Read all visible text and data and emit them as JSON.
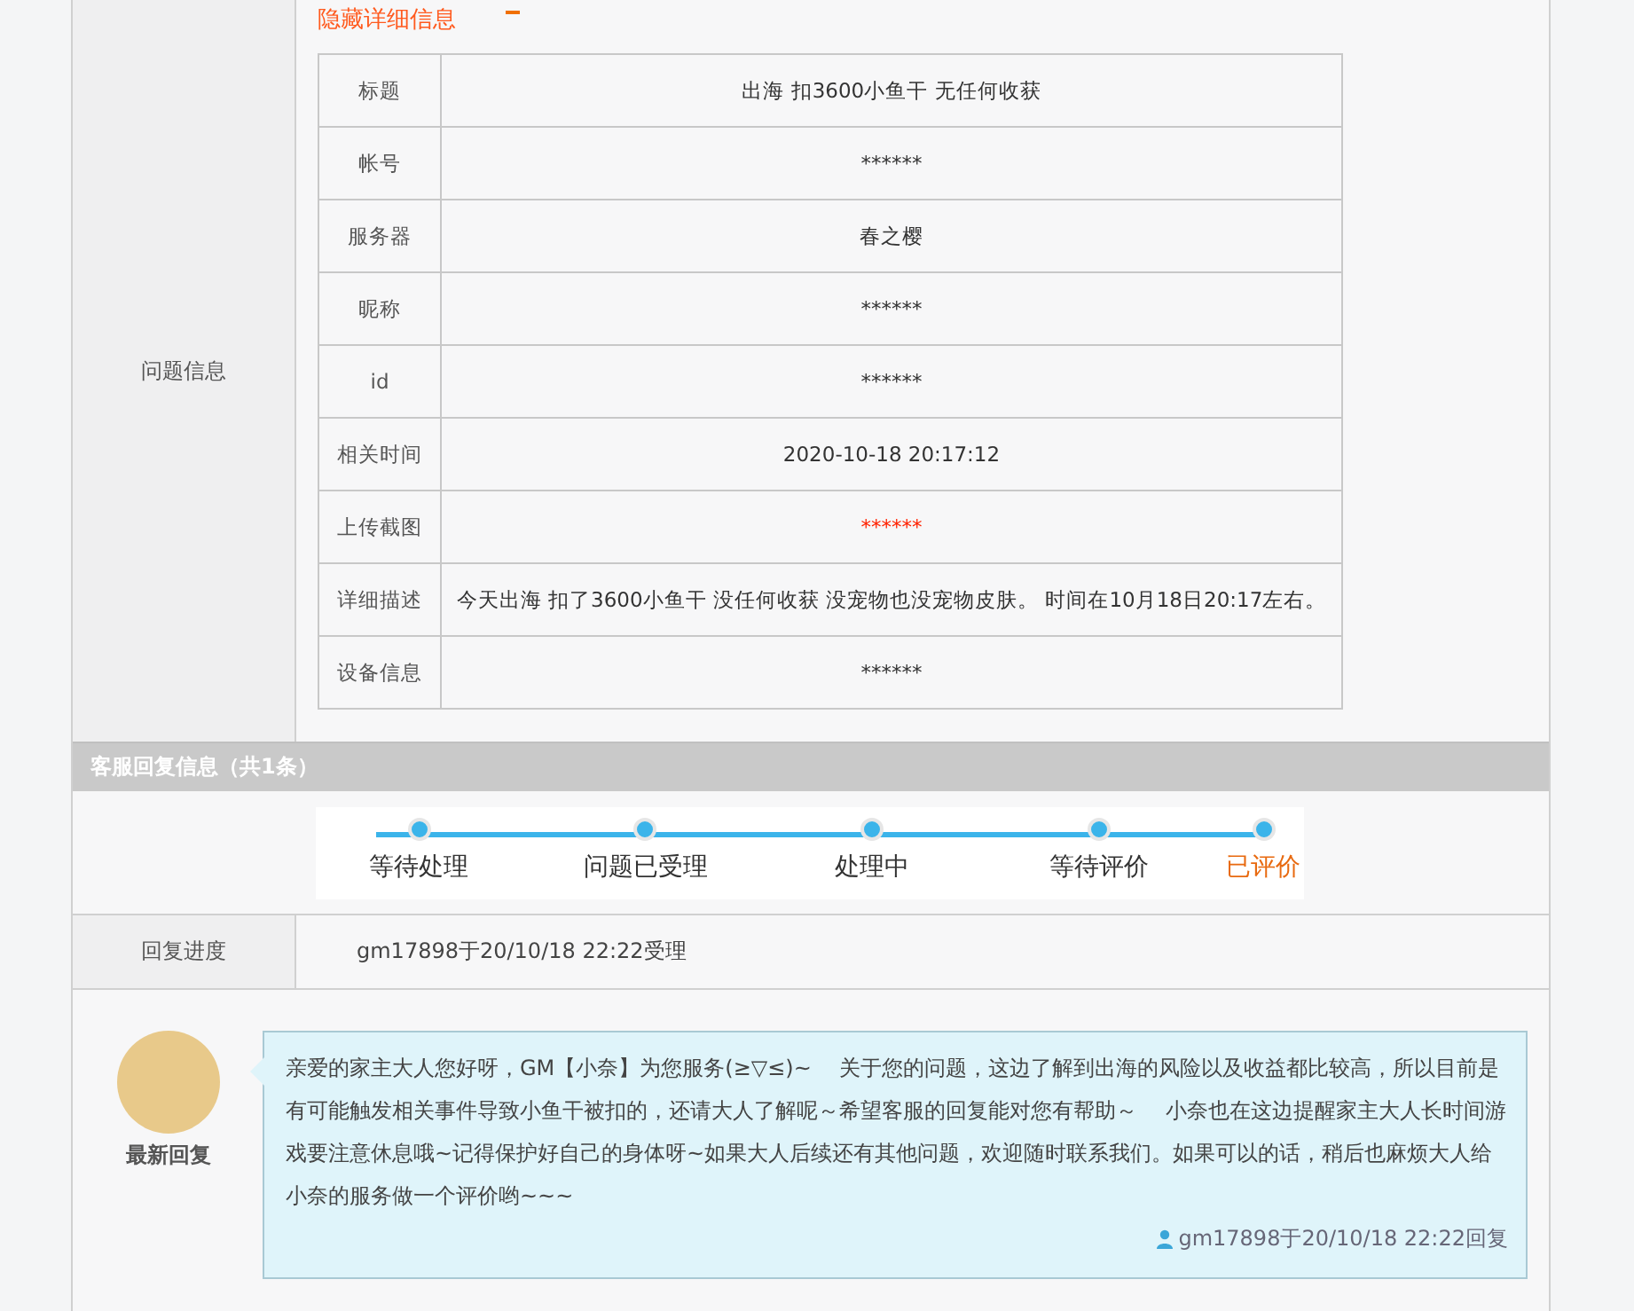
{
  "hide_details_link": "隐藏详细信息",
  "issue_info": {
    "label": "问题信息",
    "rows": [
      {
        "field": "标题",
        "value": "出海 扣3600小鱼干 无任何收获",
        "color": "#333333"
      },
      {
        "field": "帐号",
        "value": "******",
        "color": "#333333"
      },
      {
        "field": "服务器",
        "value": "春之樱",
        "color": "#333333"
      },
      {
        "field": "昵称",
        "value": "******",
        "color": "#333333"
      },
      {
        "field": "id",
        "value": "******",
        "color": "#333333"
      },
      {
        "field": "相关时间",
        "value": "2020-10-18 20:17:12",
        "color": "#333333"
      },
      {
        "field": "上传截图",
        "value": "******",
        "color": "#ff2200"
      },
      {
        "field": "详细描述",
        "value": "今天出海 扣了3600小鱼干 没任何收获 没宠物也没宠物皮肤。 时间在10月18日20:17左右。",
        "color": "#333333"
      },
      {
        "field": "设备信息",
        "value": "******",
        "color": "#333333"
      }
    ]
  },
  "reply_header": "客服回复信息（共1条）",
  "progress_steps": [
    {
      "label": "等待处理",
      "selected": false
    },
    {
      "label": "问题已受理",
      "selected": false
    },
    {
      "label": "处理中",
      "selected": false
    },
    {
      "label": "等待评价",
      "selected": false
    },
    {
      "label": "已评价",
      "selected": true
    }
  ],
  "reply_progress": {
    "label": "回复进度",
    "value": "gm17898于20/10/18 22:22受理"
  },
  "reply": {
    "avatar_caption": "最新回复",
    "message": "亲爱的家主大人您好呀，GM【小奈】为您服务(≥▽≤)~　 关于您的问题，这边了解到出海的风险以及收益都比较高，所以目前是有可能触发相关事件导致小鱼干被扣的，还请大人了解呢～希望客服的回复能对您有帮助～　 小奈也在这边提醒家主大人长时间游戏要注意休息哦~记得保护好自己的身体呀~如果大人后续还有其他问题，欢迎随时联系我们。如果可以的话，稍后也麻烦大人给小奈的服务做一个评价哟~~~",
    "signature": "gm17898于20/10/18 22:22回复"
  }
}
